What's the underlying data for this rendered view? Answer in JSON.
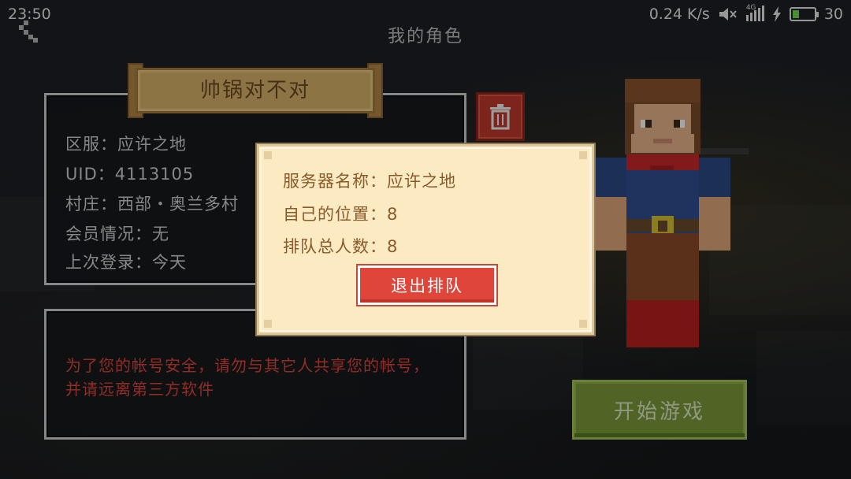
{
  "status_bar": {
    "time": "23:50",
    "net_speed": "0.24 K/s",
    "network": "4G",
    "battery": "30"
  },
  "page": {
    "title": "我的角色"
  },
  "character": {
    "name": "帅锅对不对",
    "info": [
      "区服：应许之地",
      "UID：4113105",
      "村庄：西部・奥兰多村",
      "会员情况：无",
      "上次登录：今天"
    ]
  },
  "warning": "为了您的帐号安全，请勿与其它人共享您的帐号，并请远离第三方软件",
  "start_button": "开始游戏",
  "queue_dialog": {
    "server_name": "服务器名称：应许之地",
    "own_position": "自己的位置：8",
    "queue_total": "排队总人数：8",
    "leave_button": "退出排队"
  },
  "colors": {
    "warning": "#e0453a",
    "dialog_bg": "#fbeac2",
    "start_button": "#7a9a3a",
    "delete_button": "#c0392b"
  },
  "icons": [
    "back-icon",
    "mute-icon",
    "signal-icon",
    "charging-icon",
    "battery-icon",
    "trash-icon"
  ]
}
